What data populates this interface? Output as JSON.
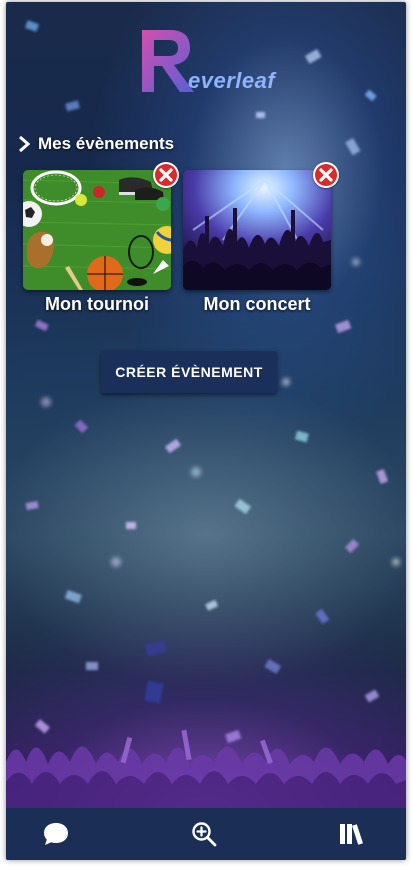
{
  "app": {
    "logo_text": "everleaf",
    "logo_icon": "reverleaf-R-logo"
  },
  "events": {
    "section_title": "Mes évènements",
    "items": [
      {
        "label": "Mon tournoi",
        "image": "sports-equipment-on-grass"
      },
      {
        "label": "Mon concert",
        "image": "concert-crowd-stage-lights"
      }
    ],
    "delete_icon": "delete-x-icon"
  },
  "actions": {
    "create_label": "CRÉER ÉVÈNEMENT"
  },
  "bottom_nav": {
    "items": [
      "chat-icon",
      "zoom-in-icon",
      "library-icon"
    ]
  },
  "colors": {
    "primary": "#1b2e56",
    "delete": "#d92b2b",
    "logo_gradient_start": "#d24fae",
    "logo_gradient_end": "#5a5fd6"
  }
}
